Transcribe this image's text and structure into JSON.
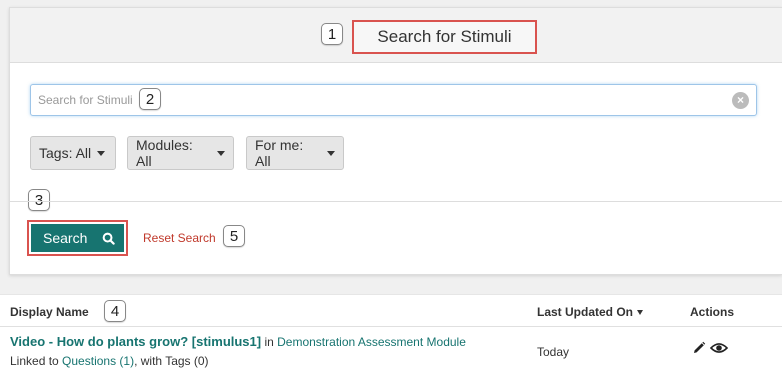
{
  "header": {
    "title": "Search for Stimuli"
  },
  "callouts": {
    "c1": "1",
    "c2": "2",
    "c3": "3",
    "c4": "4",
    "c5": "5"
  },
  "search": {
    "placeholder": "Search for Stimuli",
    "value": ""
  },
  "filters": {
    "tags": "Tags: All",
    "modules": "Modules: All",
    "for_me": "For me: All"
  },
  "buttons": {
    "search": "Search",
    "reset": "Reset Search"
  },
  "table": {
    "columns": {
      "display_name": "Display Name",
      "last_updated": "Last Updated On",
      "actions": "Actions"
    },
    "rows": [
      {
        "name": "Video - How do plants grow? [stimulus1]",
        "in_text": " in ",
        "module": "Demonstration Assessment Module",
        "linked_prefix": "Linked to ",
        "questions_link": "Questions (1)",
        "tags_text": ", with Tags (0)",
        "updated": "Today"
      }
    ]
  },
  "icons": {
    "search": "search-icon",
    "clear": "clear-icon",
    "edit": "pencil-icon",
    "view": "eye-icon"
  },
  "colors": {
    "accent": "#177470",
    "highlight": "#d9534f",
    "reset_link": "#c0392b"
  }
}
